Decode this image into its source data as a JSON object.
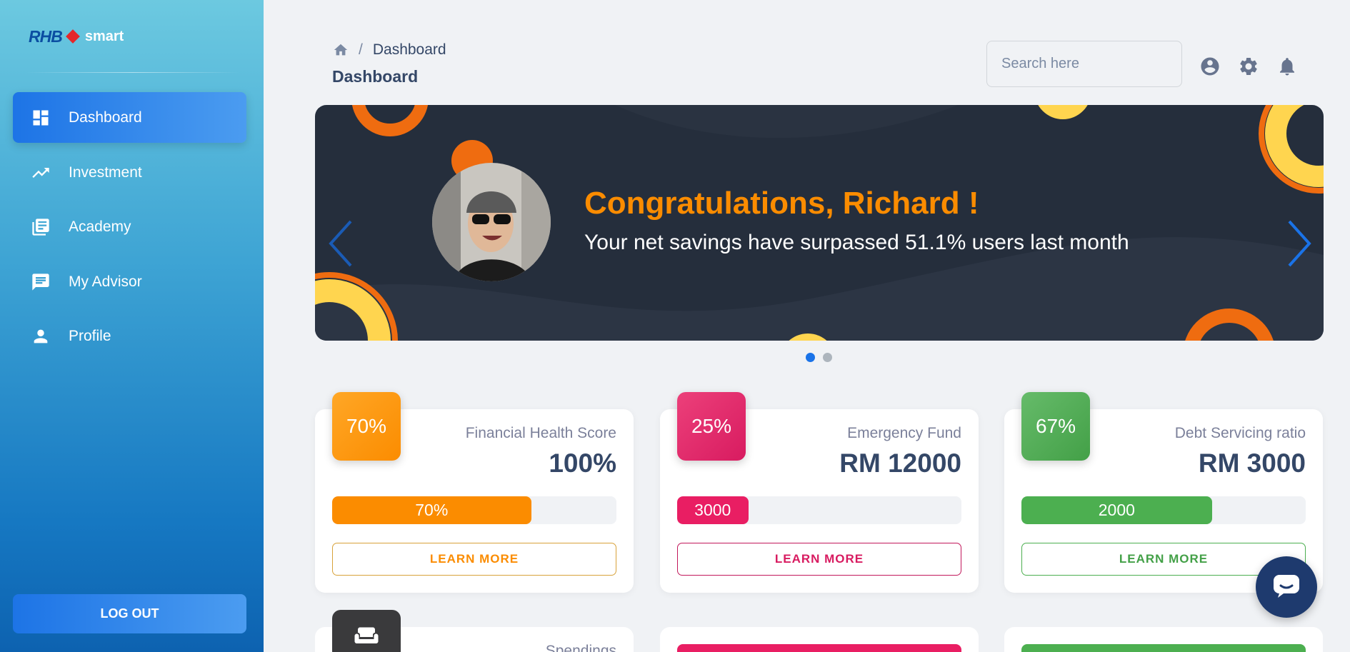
{
  "brand": {
    "logo_text": "RHB",
    "product": "smart"
  },
  "sidebar": {
    "items": [
      {
        "label": "Dashboard",
        "icon": "dashboard-icon",
        "active": true
      },
      {
        "label": "Investment",
        "icon": "trending-up-icon"
      },
      {
        "label": "Academy",
        "icon": "library-books-icon"
      },
      {
        "label": "My Advisor",
        "icon": "chat-icon"
      },
      {
        "label": "Profile",
        "icon": "person-icon"
      }
    ],
    "logout_label": "LOG OUT"
  },
  "header": {
    "breadcrumb_current": "Dashboard",
    "breadcrumb_separator": "/",
    "title": "Dashboard",
    "search_placeholder": "Search here",
    "icons": [
      "account-circle-icon",
      "settings-icon",
      "notifications-icon"
    ]
  },
  "banner": {
    "title": "Congratulations, Richard !",
    "subtitle": "Your net savings have surpassed 51.1% users last month",
    "slides": 2,
    "active_slide": 1
  },
  "cards": [
    {
      "badge": "70%",
      "label": "Financial Health Score",
      "value": "100%",
      "bar_text": "70%",
      "progress": 0.7,
      "button": "LEARN MORE",
      "color": "#fb8c00"
    },
    {
      "badge": "25%",
      "label": "Emergency Fund",
      "value": "RM 12000",
      "bar_text": "3000",
      "progress": 0.25,
      "button": "LEARN MORE",
      "color": "#e91e63"
    },
    {
      "badge": "67%",
      "label": "Debt Servicing ratio",
      "value": "RM 3000",
      "bar_text": "2000",
      "progress": 0.67,
      "button": "LEARN MORE",
      "color": "#4caf50"
    }
  ],
  "cards_row2": [
    {
      "label": "Spendings",
      "icon": "sofa-icon",
      "color": "#3a3a3c"
    },
    {
      "color": "#e91e63"
    },
    {
      "color": "#4caf50"
    }
  ],
  "colors": {
    "accent": "#1a73e8",
    "banner_bg": "#252e3c",
    "title_orange": "#fb8c00"
  }
}
